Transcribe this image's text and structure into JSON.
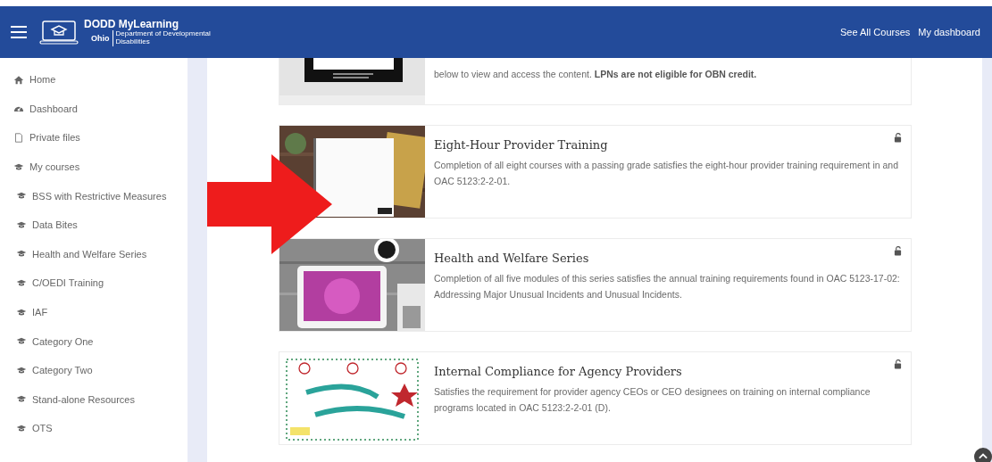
{
  "header": {
    "brand": "DODD MyLearning",
    "state": "Ohio",
    "department": "Department of Developmental Disabilities",
    "links": [
      "See All Courses",
      "My dashboard"
    ]
  },
  "sidebar": {
    "items": [
      {
        "label": "Home",
        "kind": "home"
      },
      {
        "label": "Dashboard",
        "kind": "dashboard"
      },
      {
        "label": "Private files",
        "kind": "file"
      },
      {
        "label": "My courses",
        "kind": "course",
        "children": [
          {
            "label": "BSS with Restrictive Measures",
            "kind": "course"
          },
          {
            "label": "Data Bites",
            "kind": "course"
          },
          {
            "label": "Health and Welfare Series",
            "kind": "course"
          },
          {
            "label": "C/OEDI Training",
            "kind": "course"
          },
          {
            "label": "IAF",
            "kind": "course"
          },
          {
            "label": "Category One",
            "kind": "course"
          },
          {
            "label": "Category Two",
            "kind": "course"
          },
          {
            "label": "Stand-alone Resources",
            "kind": "course"
          },
          {
            "label": "OTS",
            "kind": "course"
          }
        ]
      }
    ]
  },
  "courses": [
    {
      "partial": true,
      "summary": "below to view and access the content. **LPNs are not eligible for OBN credit.**"
    },
    {
      "partial": false,
      "title": "Eight-Hour Provider Training",
      "summary": "Completion of all eight courses with a passing grade satisfies the eight-hour provider training requirement in and OAC 5123:2-2-01."
    },
    {
      "partial": false,
      "title": "Health and Welfare Series",
      "summary": "Completion of all five modules of this series satisfies the annual training requirements found in OAC 5123-17-02: Addressing Major Unusual Incidents and Unusual Incidents."
    },
    {
      "partial": false,
      "title": "Internal Compliance for Agency Providers",
      "summary": "Satisfies the requirement for provider agency CEOs or CEO designees on training on internal compliance programs located in OAC 5123:2-2-01 (D)."
    }
  ]
}
